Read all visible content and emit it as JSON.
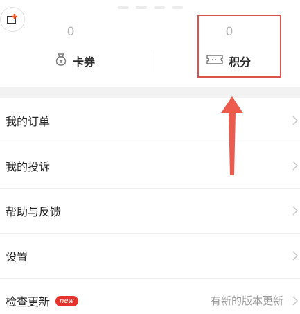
{
  "stats": [
    {
      "value": "0",
      "label": "卡券",
      "icon": "coupon-bag-icon"
    },
    {
      "value": "0",
      "label": "积分",
      "icon": "ticket-icon"
    }
  ],
  "menu": {
    "items": [
      {
        "label": "我的订单"
      },
      {
        "label": "我的投诉"
      },
      {
        "label": "帮助与反馈"
      },
      {
        "label": "设置"
      },
      {
        "label": "检查更新",
        "badge": "new",
        "value": "有新的版本更新"
      }
    ]
  },
  "colors": {
    "annotation": "#d9534f",
    "badge": "#e5322d",
    "corner_icon_accent": "#f15a24"
  }
}
